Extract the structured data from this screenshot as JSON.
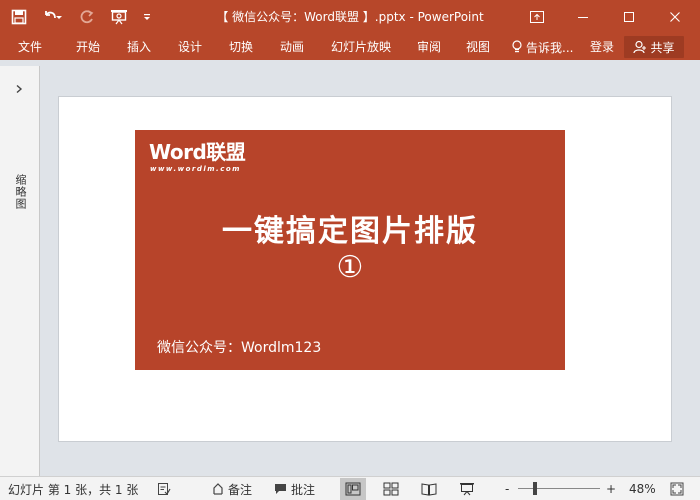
{
  "window": {
    "title": "【 微信公众号：Word联盟 】.pptx - PowerPoint",
    "accent_color": "#b7472a"
  },
  "qat": {
    "icons": [
      "save-icon",
      "undo-icon",
      "redo-icon",
      "presentation-icon",
      "customize-icon"
    ]
  },
  "ribbon": {
    "tabs": [
      "文件",
      "开始",
      "插入",
      "设计",
      "切换",
      "动画",
      "幻灯片放映",
      "审阅",
      "视图"
    ],
    "tell_me": "告诉我...",
    "login": "登录",
    "share": "共享"
  },
  "left_pane": {
    "label": "缩略图"
  },
  "slide": {
    "logo_main": "Word联盟",
    "logo_sub": "www.wordlm.com",
    "title": "一键搞定图片排版",
    "number": "①",
    "footer": "微信公众号：Wordlm123",
    "background_color": "#b7442a"
  },
  "status": {
    "slide_info": "幻灯片 第 1 张，共 1 张",
    "notes": "备注",
    "comments": "批注",
    "zoom_minus": "-",
    "zoom_plus": "+",
    "zoom_percent": "48%",
    "zoom_value": 48
  }
}
